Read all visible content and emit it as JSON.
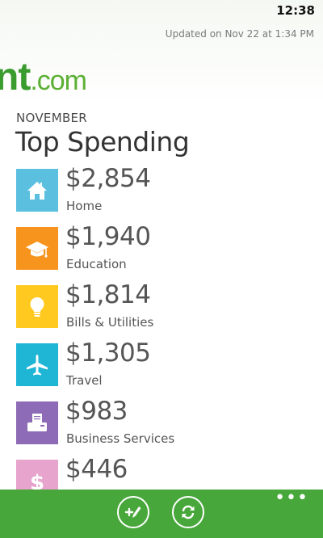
{
  "status_bar": {
    "time": "12:38"
  },
  "updated_text": "Updated on Nov 22 at 1:34 PM",
  "brand": {
    "part1": "nt",
    "part2": ".com"
  },
  "month": "NOVEMBER",
  "section_title": "Top Spending",
  "spending": [
    {
      "amount": "$2,854",
      "category": "Home",
      "icon": "home-icon",
      "color": "#5bc0e0"
    },
    {
      "amount": "$1,940",
      "category": "Education",
      "icon": "graduation-cap-icon",
      "color": "#f7941d"
    },
    {
      "amount": "$1,814",
      "category": "Bills & Utilities",
      "icon": "lightbulb-icon",
      "color": "#ffc920"
    },
    {
      "amount": "$1,305",
      "category": "Travel",
      "icon": "airplane-icon",
      "color": "#1fb6d6"
    },
    {
      "amount": "$983",
      "category": "Business Services",
      "icon": "fax-icon",
      "color": "#8e6bb6"
    },
    {
      "amount": "$446",
      "category": "",
      "icon": "dollar-icon",
      "color": "#e7a4cc"
    }
  ],
  "app_bar": {
    "color": "#47a73a",
    "buttons": [
      "edit-icon",
      "refresh-icon"
    ],
    "more_label": "•••"
  }
}
